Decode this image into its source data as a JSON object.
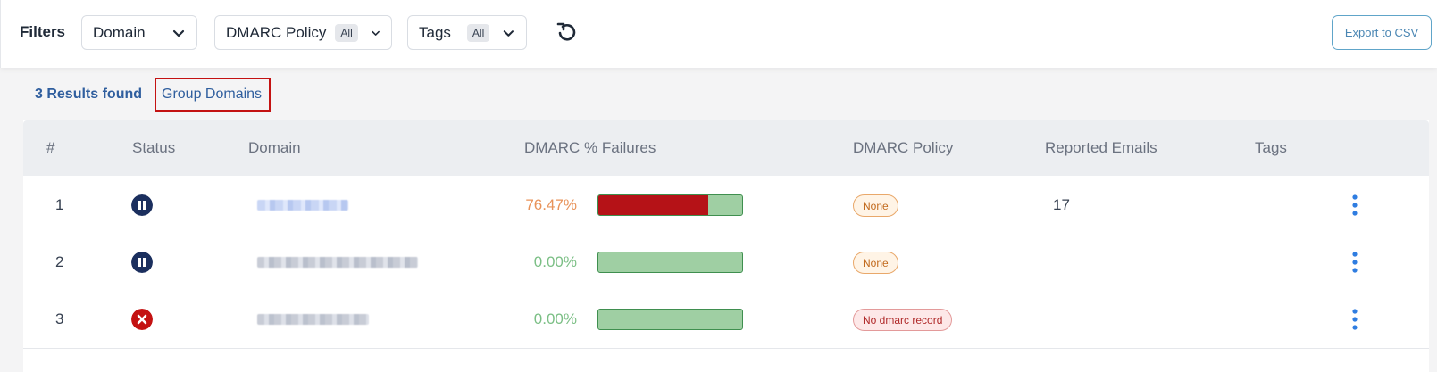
{
  "filters": {
    "label": "Filters",
    "domain_dropdown": "Domain",
    "dmarc_policy_dropdown": "DMARC Policy",
    "dmarc_policy_badge": "All",
    "tags_dropdown": "Tags",
    "tags_badge": "All",
    "reset_icon": "refresh-icon",
    "export_button": "Export to CSV"
  },
  "results": {
    "count_text": "3 Results found",
    "group_domains_link": "Group Domains"
  },
  "table": {
    "columns": [
      "#",
      "Status",
      "Domain",
      "DMARC % Failures",
      "DMARC Policy",
      "Reported Emails",
      "Tags"
    ],
    "rows": [
      {
        "index": "1",
        "status": "paused",
        "status_icon": "pause-icon",
        "domain": "",
        "failures_text": "76.47%",
        "failures_fraction": 0.7647,
        "policy": "None",
        "reported_emails": "17",
        "tags": ""
      },
      {
        "index": "2",
        "status": "paused",
        "status_icon": "pause-icon",
        "domain": "",
        "failures_text": "0.00%",
        "failures_fraction": 0.0,
        "policy": "None",
        "reported_emails": "",
        "tags": ""
      },
      {
        "index": "3",
        "status": "error",
        "status_icon": "error-x-icon",
        "domain": "",
        "failures_text": "0.00%",
        "failures_fraction": 0.0,
        "policy": "No dmarc record",
        "reported_emails": "",
        "tags": ""
      }
    ]
  },
  "colors": {
    "accent_blue": "#2f5e9e",
    "fail_red": "#b51217",
    "pass_green": "#9fcfa3",
    "pct_high": "#e8935a",
    "pct_low": "#7bbf85",
    "status_paused": "#1b2f5e",
    "status_error": "#c41212",
    "kebab_blue": "#2f7de1"
  }
}
